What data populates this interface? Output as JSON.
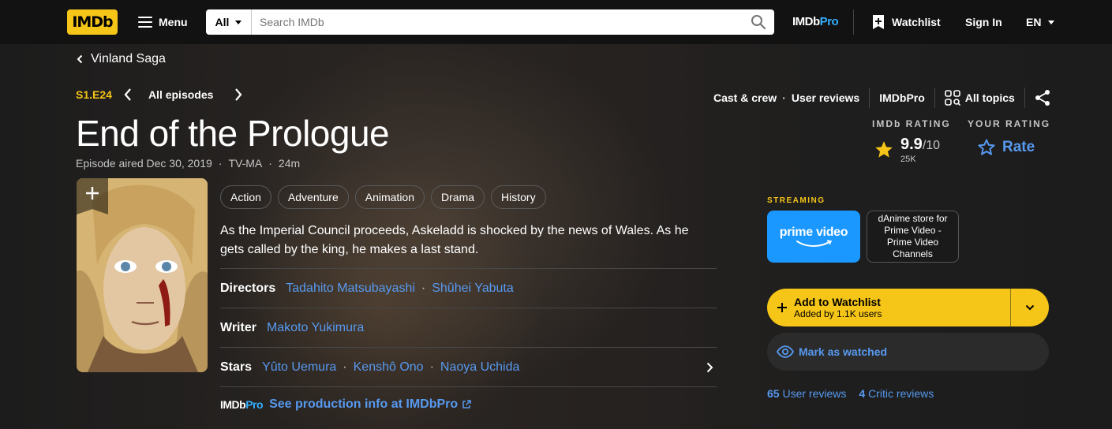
{
  "nav": {
    "logo": "IMDb",
    "menu_label": "Menu",
    "search_category": "All",
    "search_placeholder": "Search IMDb",
    "pro_logo_a": "IMDb",
    "pro_logo_b": "Pro",
    "watchlist_label": "Watchlist",
    "signin_label": "Sign In",
    "language": "EN"
  },
  "series": {
    "back_label": "Vinland Saga"
  },
  "episode": {
    "code": "S1.E24",
    "all_episodes_label": "All episodes",
    "title": "End of the Prologue",
    "aired": "Episode aired Dec 30, 2019",
    "certificate": "TV-MA",
    "runtime": "24m",
    "genres": [
      "Action",
      "Adventure",
      "Animation",
      "Drama",
      "History"
    ],
    "plot": "As the Imperial Council proceeds, Askeladd is shocked by the news of Wales. As he gets called by the king, he makes a last stand."
  },
  "top_links": {
    "cast_crew": "Cast & crew",
    "user_reviews": "User reviews",
    "imdbpro": "IMDbPro",
    "all_topics": "All topics"
  },
  "rating": {
    "imdb_label": "IMDb RATING",
    "score": "9.9",
    "max": "/10",
    "count": "25K",
    "your_label": "YOUR RATING",
    "rate_label": "Rate"
  },
  "credits": {
    "directors_label": "Directors",
    "directors": [
      "Tadahito Matsubayashi",
      "Shûhei Yabuta"
    ],
    "writer_label": "Writer",
    "writers": [
      "Makoto Yukimura"
    ],
    "stars_label": "Stars",
    "stars": [
      "Yûto Uemura",
      "Kenshô Ono",
      "Naoya Uchida"
    ]
  },
  "production": {
    "logo_a": "IMDb",
    "logo_b": "Pro",
    "link_label": "See production info at IMDbPro"
  },
  "streaming": {
    "label": "STREAMING",
    "prime_label": "prime video",
    "danime_label": "dAnime store for Prime Video - Prime Video Channels"
  },
  "actions": {
    "add_watchlist_title": "Add to Watchlist",
    "add_watchlist_sub": "Added by 1.1K users",
    "mark_watched": "Mark as watched"
  },
  "reviews": {
    "user_count": "65",
    "user_label": "User reviews",
    "critic_count": "4",
    "critic_label": "Critic reviews"
  },
  "colors": {
    "accent_yellow": "#f5c518",
    "link_blue": "#5799ef",
    "prime_blue": "#1a98ff"
  }
}
